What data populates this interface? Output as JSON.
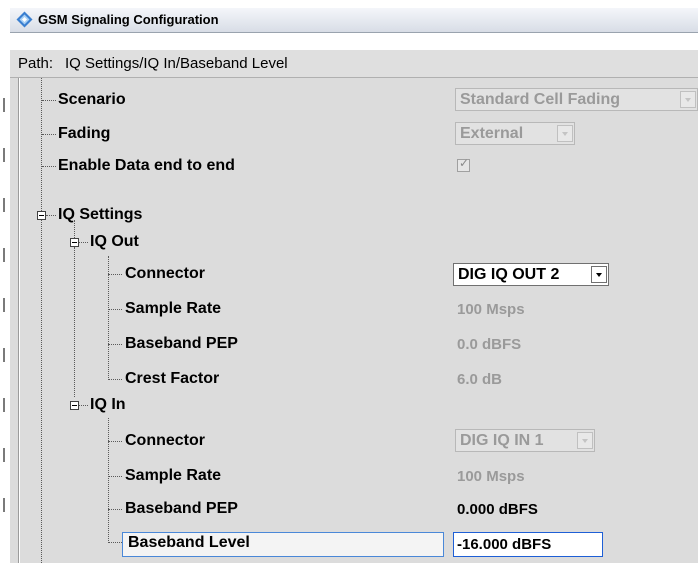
{
  "window": {
    "title": "GSM Signaling Configuration",
    "icon": "rohde-schwarz-logo-icon"
  },
  "path_bar": {
    "label": "Path:",
    "value": "IQ Settings/IQ In/Baseband Level"
  },
  "tree": {
    "scenario": {
      "label": "Scenario",
      "value": "Standard Cell Fading"
    },
    "fading": {
      "label": "Fading",
      "value": "External"
    },
    "enable_data": {
      "label": "Enable Data end to end",
      "checked": true
    },
    "iq_settings": {
      "label": "IQ Settings"
    },
    "iq_out": {
      "label": "IQ Out",
      "connector": {
        "label": "Connector",
        "value": "DIG IQ OUT 2"
      },
      "sample_rate": {
        "label": "Sample Rate",
        "value": "100 Msps"
      },
      "baseband_pep": {
        "label": "Baseband PEP",
        "value": "0.0 dBFS"
      },
      "crest_factor": {
        "label": "Crest Factor",
        "value": "6.0 dB"
      }
    },
    "iq_in": {
      "label": "IQ In",
      "connector": {
        "label": "Connector",
        "value": "DIG IQ IN 1"
      },
      "sample_rate": {
        "label": "Sample Rate",
        "value": "100 Msps"
      },
      "baseband_pep": {
        "label": "Baseband PEP",
        "value": "0.000 dBFS"
      },
      "baseband_level": {
        "label": "Baseband Level",
        "value": "-16.000 dBFS"
      }
    }
  }
}
